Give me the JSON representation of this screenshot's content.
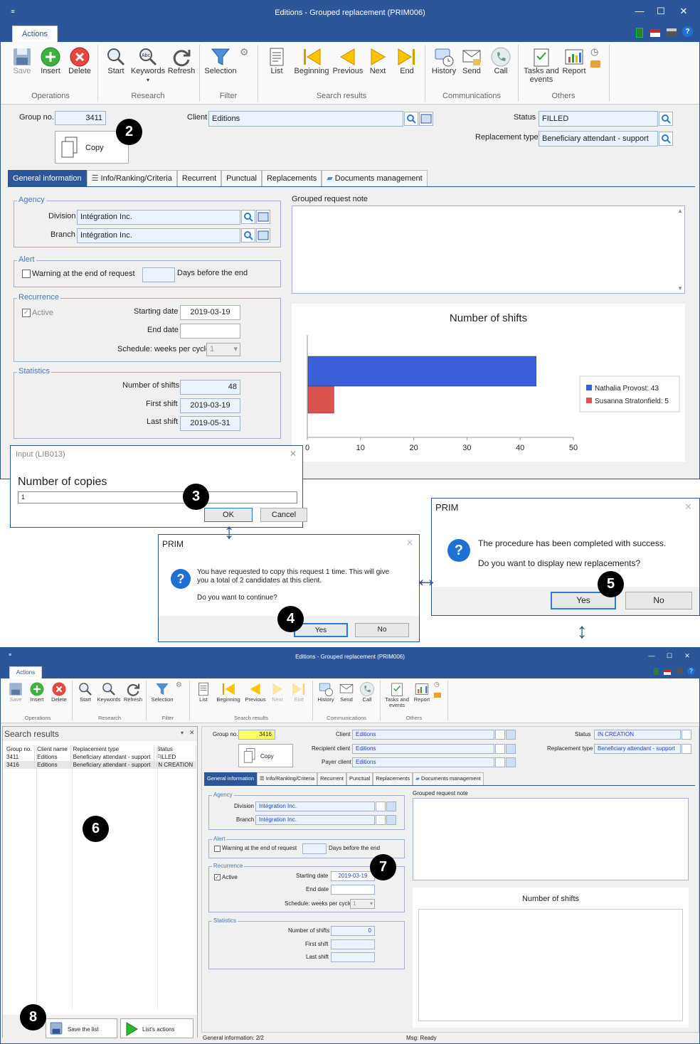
{
  "top": {
    "title": "Editions - Grouped replacement (PRIM006)",
    "tab_actions": "Actions",
    "ribbon": [
      {
        "label": "Save",
        "icon": "save-icon"
      },
      {
        "label": "Insert",
        "icon": "insert-icon"
      },
      {
        "label": "Delete",
        "icon": "delete-icon"
      },
      {
        "label": "Start",
        "icon": "search-icon"
      },
      {
        "label": "Keywords",
        "icon": "keywords-icon"
      },
      {
        "label": "Refresh",
        "icon": "refresh-icon"
      },
      {
        "label": "Selection",
        "icon": "filter-icon"
      },
      {
        "label": "List",
        "icon": "list-icon"
      },
      {
        "label": "Beginning",
        "icon": "first-icon"
      },
      {
        "label": "Previous",
        "icon": "previous-icon"
      },
      {
        "label": "Next",
        "icon": "next-icon"
      },
      {
        "label": "End",
        "icon": "last-icon"
      },
      {
        "label": "History",
        "icon": "history-icon"
      },
      {
        "label": "Send",
        "icon": "send-icon"
      },
      {
        "label": "Call",
        "icon": "call-icon"
      },
      {
        "label": "Tasks and events",
        "icon": "tasks-icon"
      },
      {
        "label": "Report",
        "icon": "report-icon"
      }
    ],
    "groups": [
      "Operations",
      "Research",
      "Filter",
      "Search results",
      "Communications",
      "Others"
    ],
    "group_no_label": "Group no.",
    "group_no": "3411",
    "copy_label": "Copy",
    "client_label": "Client",
    "client": "Editions",
    "status_label": "Status",
    "status": "FILLED",
    "repl_type_label": "Replacement type",
    "repl_type": "Beneficiary attendant - support",
    "tabs": [
      "General information",
      "Info/Ranking/Criteria",
      "Recurrent",
      "Punctual",
      "Replacements",
      "Documents management"
    ],
    "agency_legend": "Agency",
    "division_label": "Division",
    "division": "Intégration Inc.",
    "branch_label": "Branch",
    "branch": "Intégration Inc.",
    "alert_legend": "Alert",
    "warning_label": "Warning at the end of request",
    "days_label": "Days before the end",
    "recurrence_legend": "Recurrence",
    "active_label": "Active",
    "starting_date_label": "Starting date",
    "starting_date": "2019-03-19",
    "end_date_label": "End date",
    "schedule_label": "Schedule: weeks per cycle",
    "schedule_value": "1",
    "stats_legend": "Statistics",
    "nshifts_label": "Number of shifts",
    "nshifts": "48",
    "first_shift_label": "First shift",
    "first_shift": "2019-03-19",
    "last_shift_label": "Last shift",
    "last_shift": "2019-05-31",
    "note_label": "Grouped request note"
  },
  "chart_data": {
    "type": "bar",
    "orientation": "horizontal",
    "title": "Number of shifts",
    "series": [
      {
        "name": "Nathalia Provost: 43",
        "value": 43,
        "color": "#3a5fd9"
      },
      {
        "name": "Susanna Stratonfield: 5",
        "value": 5,
        "color": "#d9534f"
      }
    ],
    "xlim": [
      0,
      50
    ],
    "xticks": [
      "0",
      "10",
      "20",
      "30",
      "40",
      "50"
    ],
    "legend": "right"
  },
  "input_dialog": {
    "title": "Input (LIB013)",
    "prompt": "Number of copies",
    "value": "1",
    "ok": "OK",
    "cancel": "Cancel"
  },
  "confirm_dialog": {
    "title": "PRIM",
    "line1": "You have requested to copy this request 1 time. This will give",
    "line2": "you a total of 2 candidates at this client.",
    "line3": "Do you want to continue?",
    "yes": "Yes",
    "no": "No"
  },
  "success_dialog": {
    "title": "PRIM",
    "line1": "The procedure has been completed with success.",
    "line2": "Do you want to display new replacements?",
    "yes": "Yes",
    "no": "No"
  },
  "steps": [
    "2",
    "3",
    "4",
    "5",
    "6",
    "7",
    "8"
  ],
  "bottom": {
    "title": "Editions - Grouped replacement (PRIM006)",
    "tab_actions": "Actions",
    "search_title": "Search results",
    "columns": [
      "Group no.",
      "Client name",
      "Replacement type",
      "Status"
    ],
    "rows": [
      [
        "3411",
        "Editions",
        "Beneficiary attendant - support",
        "FILLED"
      ],
      [
        "3416",
        "Editions",
        "Beneficiary attendant - support",
        "IN CREATION"
      ]
    ],
    "save_list": "Save the list",
    "list_actions": "List's actions",
    "group_no_label": "Group no.",
    "group_no": "3416",
    "copy_label": "Copy",
    "client_label": "Client",
    "client": "Editions",
    "recipient_label": "Recipient client",
    "recipient": "Editions",
    "payer_label": "Payer client",
    "payer": "Editions",
    "status_label": "Status",
    "status": "IN CREATION",
    "repl_type_label": "Replacement type",
    "repl_type": "Beneficiary attendant - support",
    "tabs": [
      "General information",
      "Info/Ranking/Criteria",
      "Recurrent",
      "Punctual",
      "Replacements",
      "Documents management"
    ],
    "agency_legend": "Agency",
    "division_label": "Division",
    "division": "Intégration Inc.",
    "branch_label": "Branch",
    "branch": "Intégration Inc.",
    "alert_legend": "Alert",
    "warning_label": "Warning at the end of request",
    "days_label": "Days before the end",
    "recurrence_legend": "Recurrence",
    "active_label": "Active",
    "starting_date_label": "Starting date",
    "starting_date": "2019-03-19",
    "end_date_label": "End date",
    "schedule_label": "Schedule: weeks per cycle",
    "schedule_value": "1",
    "stats_legend": "Statistics",
    "nshifts_label": "Number of shifts",
    "nshifts": "0",
    "first_shift_label": "First shift",
    "last_shift_label": "Last shift",
    "note_label": "Grouped request note",
    "chart_title": "Number of shifts",
    "status_left": "General information: 2/2",
    "status_right": "Msg: Ready"
  }
}
